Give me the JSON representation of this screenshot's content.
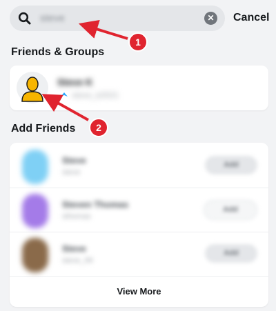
{
  "search": {
    "query": "steve",
    "cancel_label": "Cancel"
  },
  "friends_groups": {
    "title": "Friends & Groups",
    "item": {
      "name": "Steve K",
      "subtitle": "steve_k2021"
    }
  },
  "add_friends": {
    "title": "Add Friends",
    "rows": [
      {
        "name": "Steve",
        "sub": "steve",
        "button": "Add"
      },
      {
        "name": "Steven Thomas",
        "sub": "sthomas",
        "button": "Add"
      },
      {
        "name": "Steve",
        "sub": "steve_99",
        "button": "Add"
      }
    ],
    "view_more_label": "View More"
  },
  "callouts": {
    "one": "1",
    "two": "2"
  },
  "colors": {
    "accent_red": "#e0242f",
    "avatar_yellow": "#f7b500",
    "background": "#f2f3f5"
  },
  "icons": {
    "search": "search-icon",
    "clear": "clear-icon",
    "avatar": "bitmoji-placeholder-icon"
  }
}
